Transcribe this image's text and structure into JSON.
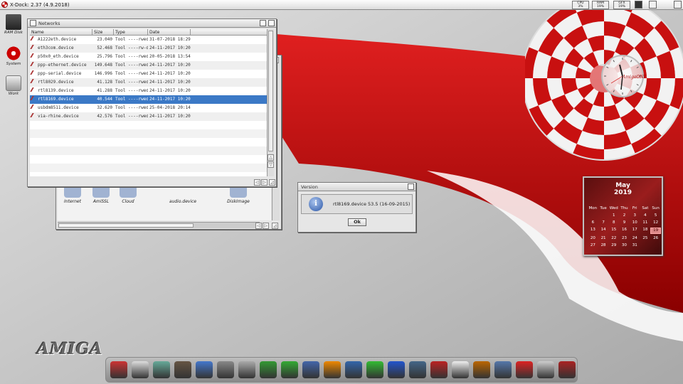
{
  "screen": {
    "title": "X-Dock: 2.37 (4.9.2018)",
    "meters": [
      {
        "label": "CPU",
        "value": "3%",
        "fraction": 0.03
      },
      {
        "label": "RAM",
        "value": "19%",
        "fraction": 0.19
      },
      {
        "label": "GFX",
        "value": "19%",
        "fraction": 0.19
      }
    ]
  },
  "desktop_icons": [
    {
      "label": "RAM Disk",
      "icon": "ram-disk-icon"
    },
    {
      "label": "System",
      "icon": "system-drive-icon"
    },
    {
      "label": "Work",
      "icon": "work-drive-icon"
    }
  ],
  "networks_window": {
    "title": "Networks",
    "columns": [
      "Name",
      "Size",
      "Type",
      "Date"
    ],
    "rows": [
      {
        "name": "A1222eth.device",
        "size": "23.040",
        "type": "Tool ----rwed",
        "date": "31-07-2018 18:29",
        "selected": false
      },
      {
        "name": "eth3com.device",
        "size": "52.468",
        "type": "Tool ----rw-d",
        "date": "24-11-2017 10:20",
        "selected": false
      },
      {
        "name": "p50x0_eth.device",
        "size": "25.796",
        "type": "Tool ----rwed",
        "date": "20-05-2018 13:54",
        "selected": false
      },
      {
        "name": "ppp-ethernet.device",
        "size": "149.648",
        "type": "Tool ----rwed",
        "date": "24-11-2017 10:20",
        "selected": false
      },
      {
        "name": "ppp-serial.device",
        "size": "146.996",
        "type": "Tool ----rwed",
        "date": "24-11-2017 10:20",
        "selected": false
      },
      {
        "name": "rtl8029.device",
        "size": "41.128",
        "type": "Tool ----rwed",
        "date": "24-11-2017 10:20",
        "selected": false
      },
      {
        "name": "rtl8139.device",
        "size": "41.288",
        "type": "Tool ----rwed",
        "date": "24-11-2017 10:20",
        "selected": false
      },
      {
        "name": "rtl8169.device",
        "size": "40.544",
        "type": "Tool ----rwed",
        "date": "24-11-2017 10:20",
        "selected": true
      },
      {
        "name": "usbdm8511.device",
        "size": "32.620",
        "type": "Tool ----rwed",
        "date": "25-04-2018 20:14",
        "selected": false
      },
      {
        "name": "via-rhine.device",
        "size": "42.576",
        "type": "Tool ----rwed",
        "date": "24-11-2017 10:20",
        "selected": false
      }
    ]
  },
  "drawer_window": {
    "icons": [
      "Internet",
      "AmiSSL",
      "Cloud",
      "audio.device",
      "DiskImage"
    ]
  },
  "version_requester": {
    "title": "Version",
    "message": "rtl8169.device 53.5 (16-09-2015)",
    "ok_label": "Ok"
  },
  "clock": {
    "brand": "AmigaONE"
  },
  "calendar": {
    "month": "May",
    "year": "2019",
    "weekdays": [
      "Mon",
      "Tue",
      "Wed",
      "Thu",
      "Fri",
      "Sat",
      "Sun"
    ],
    "first_weekday_index": 2,
    "days_in_month": 31,
    "today": 19
  },
  "logo": {
    "text": "AMIGA"
  },
  "dock": {
    "items": [
      "notes-icon",
      "cd-icon",
      "paint-icon",
      "movie-icon",
      "sphere-icon",
      "speaker-icon",
      "camera-icon",
      "pen-icon",
      "download-icon",
      "globe-icon",
      "ball-icon",
      "mountain-icon",
      "snake-icon",
      "network-icon",
      "odyssey-icon",
      "aweb-icon",
      "photo-icon",
      "book-icon",
      "monitor-icon",
      "mplayer-icon",
      "docs-icon",
      "bag-icon"
    ]
  },
  "colors": {
    "accent": "#3b79c6",
    "wallpaper_red": "#b30000",
    "wallpaper_grey": "#c8c8c8"
  }
}
